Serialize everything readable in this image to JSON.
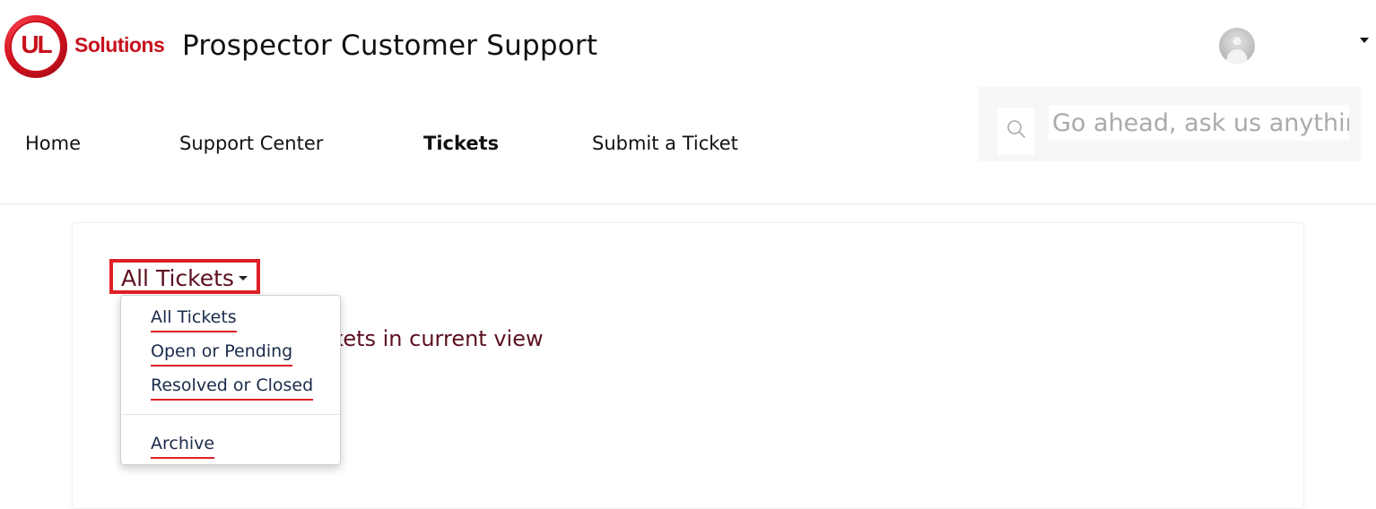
{
  "header": {
    "logo_text": "Solutions",
    "logo_mark": "UL",
    "site_title": "Prospector Customer Support",
    "user_menu_icon": "chevron-down-icon"
  },
  "nav": {
    "items": [
      {
        "label": "Home",
        "active": false
      },
      {
        "label": "Support Center",
        "active": false
      },
      {
        "label": "Tickets",
        "active": true
      },
      {
        "label": "Submit a Ticket",
        "active": false
      }
    ]
  },
  "search": {
    "placeholder": "Go ahead, ask us anything...",
    "icon": "search-icon"
  },
  "tickets": {
    "view_selector_label": "All Tickets",
    "result_text": "tickets in current view",
    "menu": {
      "items": [
        {
          "label": "All Tickets"
        },
        {
          "label": "Open or Pending"
        },
        {
          "label": "Resolved or Closed"
        },
        {
          "label": "Archive"
        }
      ]
    }
  },
  "colors": {
    "brand_red": "#c8101d",
    "highlight_red": "#e01f26",
    "dropdown_text": "#5b1020",
    "menu_text": "#1a2b4a"
  }
}
